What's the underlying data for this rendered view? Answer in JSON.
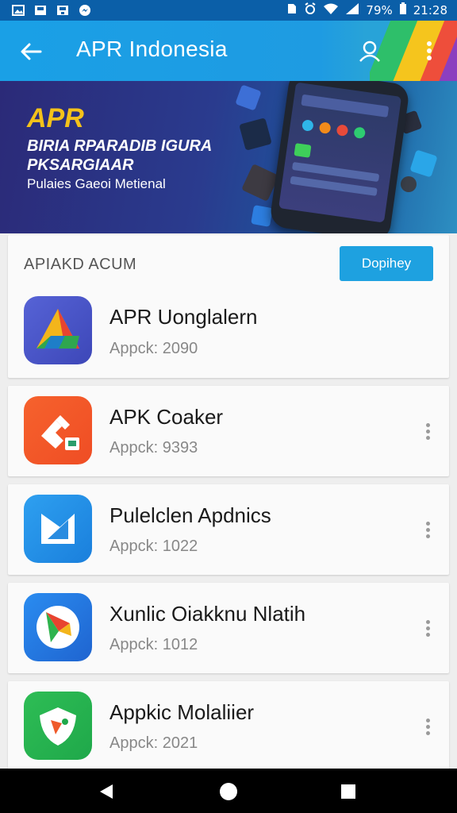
{
  "status_bar": {
    "battery": "79%",
    "time": "21:28",
    "icons": [
      "gallery-icon",
      "save-icon",
      "save-icon",
      "messenger-icon",
      "sim-icon",
      "alarm-icon",
      "wifi-icon",
      "signal-icon",
      "battery-icon"
    ]
  },
  "appbar": {
    "title": "APR Indonesia",
    "back_icon": "arrow-left-icon",
    "user_icon": "user-icon",
    "menu_icon": "more-vert-icon"
  },
  "banner": {
    "title": "APR",
    "subtitle": "BIRIA RPARADIB IGURA PKSARGIAAR",
    "small": "Pulaies Gaeoi Metienal"
  },
  "list": {
    "section_title": "APIAKD ACUM",
    "display_button": "Dopihey",
    "items": [
      {
        "name": "APR Uonglalern",
        "meta": "Appck: 2090",
        "colors": [
          "#4a56c8",
          "#2f8f4e"
        ],
        "show_more": false
      },
      {
        "name": "APK Coaker",
        "meta": "Appck: 9393",
        "colors": [
          "#f2572a",
          "#f27a2a"
        ],
        "show_more": true
      },
      {
        "name": "Pulelclen Apdnics",
        "meta": "Appck: 1022",
        "colors": [
          "#1e8fe6",
          "#2a8ce0"
        ],
        "show_more": true
      },
      {
        "name": "Xunlic Oiakknu Nlatih",
        "meta": "Appck: 1012",
        "colors": [
          "#1f6fd6",
          "#2b82e8"
        ],
        "show_more": true
      },
      {
        "name": "Appkic Molaliier",
        "meta": "Appck: 2021",
        "colors": [
          "#1fa84a",
          "#2fbd55"
        ],
        "show_more": true
      }
    ]
  },
  "navbar": {
    "back": "back-triangle-icon",
    "home": "home-circle-icon",
    "recents": "recents-square-icon"
  },
  "colors": {
    "primary": "#1ea1e0",
    "status_bar": "#0b5fa8",
    "banner_title": "#f4c21a"
  }
}
